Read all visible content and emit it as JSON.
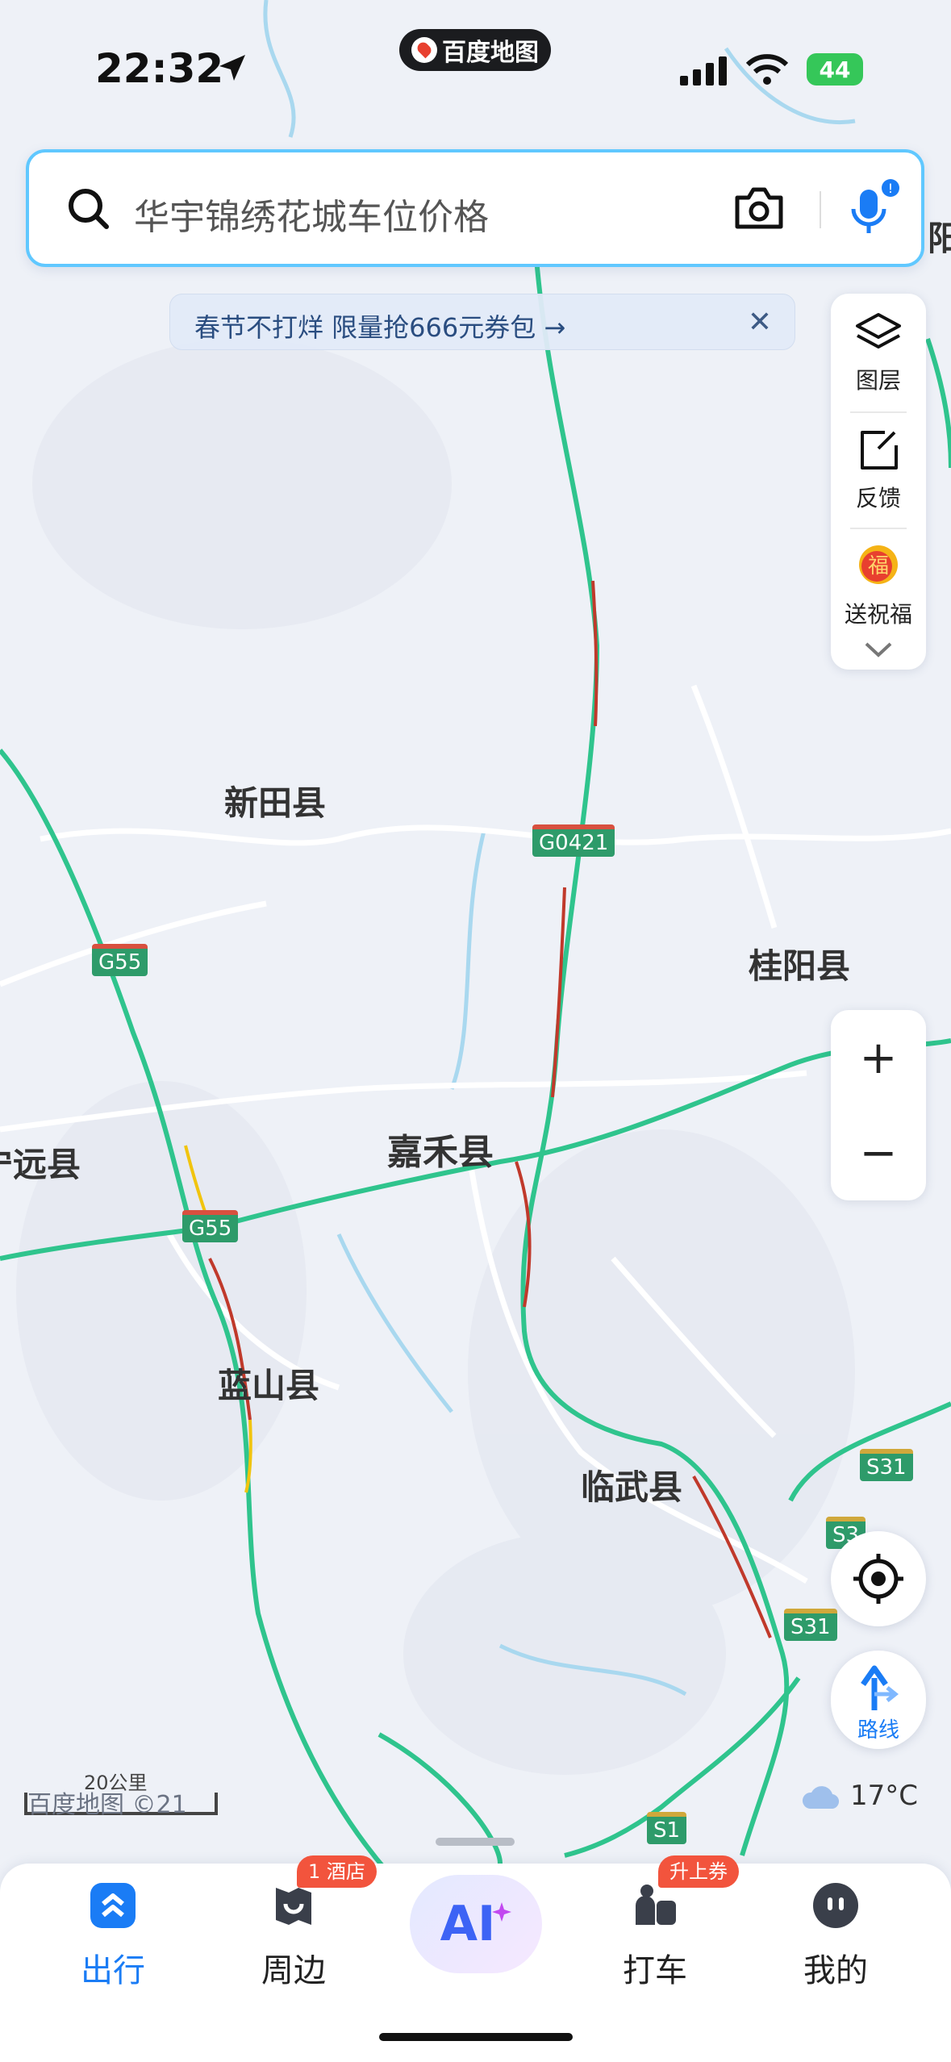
{
  "status_bar": {
    "time": "22:32",
    "app_name": "百度地图",
    "battery": "44"
  },
  "search": {
    "placeholder": "华宇锦绣花城车位价格"
  },
  "promo": {
    "text": "春节不打烊 限量抢666元券包 →",
    "close": "✕"
  },
  "tools": [
    {
      "label": "图层",
      "icon": "layers-icon"
    },
    {
      "label": "反馈",
      "icon": "feedback-icon"
    },
    {
      "label": "送祝福",
      "icon": "blessing-icon"
    }
  ],
  "map": {
    "places": [
      "新田县",
      "桂阳县",
      "宁远县",
      "嘉禾县",
      "蓝山县",
      "临武县"
    ],
    "partial_place": "阳",
    "road_shields": [
      "G0421",
      "G55",
      "G55",
      "S31",
      "S31",
      "S3",
      "S1"
    ]
  },
  "zoom": {
    "in": "+",
    "out": "−"
  },
  "route": {
    "label": "路线"
  },
  "scale": {
    "distance": "20公里",
    "watermark": "百度地图 ©21"
  },
  "weather": {
    "temp": "17°C"
  },
  "tabbar": {
    "tabs": [
      {
        "label": "出行",
        "active": true
      },
      {
        "label": "周边",
        "badge": "1 酒店"
      },
      {
        "label": "AI"
      },
      {
        "label": "打车",
        "badge": "升上券"
      },
      {
        "label": "我的"
      }
    ]
  },
  "colors": {
    "accent": "#1a7cf5",
    "road_green": "#2fc48d",
    "congestion": "#c0392b"
  }
}
